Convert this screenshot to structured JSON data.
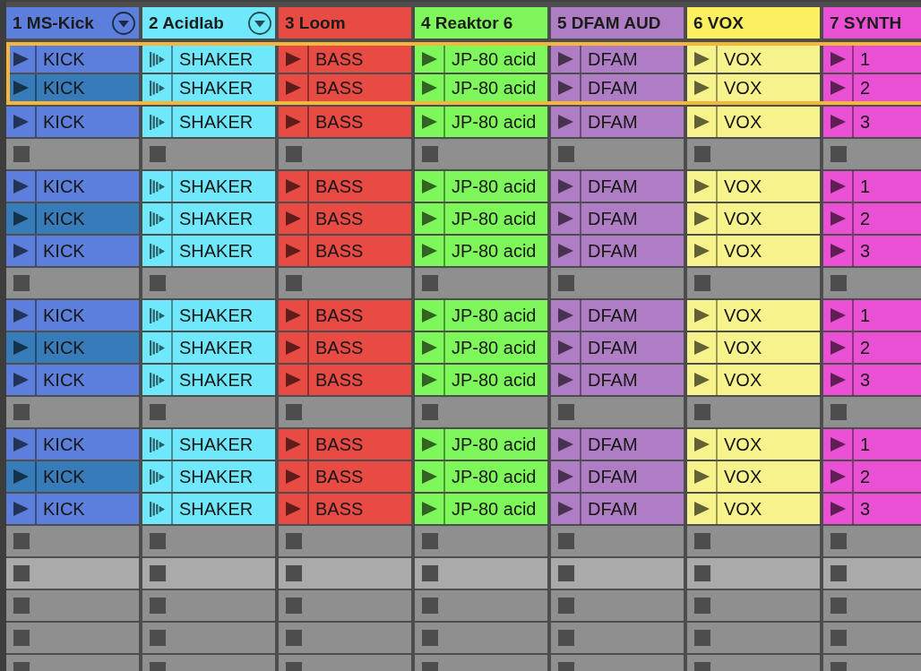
{
  "tracks": [
    {
      "name": "1 MS-Kick",
      "color": "#5c7fdc",
      "dropdown": true
    },
    {
      "name": "2 Acidlab",
      "color": "#6fe8fc",
      "dropdown": true
    },
    {
      "name": "3 Loom",
      "color": "#e84b44",
      "dropdown": false
    },
    {
      "name": "4 Reaktor 6",
      "color": "#7df75a",
      "dropdown": false
    },
    {
      "name": "5 DFAM AUD",
      "color": "#ae7dc4",
      "dropdown": false
    },
    {
      "name": "6 VOX",
      "color": "#fcef60",
      "dropdown": false
    },
    {
      "name": "7 SYNTH",
      "color": "#ea50d3",
      "dropdown": false
    }
  ],
  "scenes": [
    {
      "selected": true,
      "highlighted": false,
      "cells": [
        {
          "kind": "clip",
          "name": "KICK",
          "color": "#5c7fdc"
        },
        {
          "kind": "repeat",
          "name": "SHAKER",
          "color": "#6fe8fc"
        },
        {
          "kind": "clip",
          "name": "BASS",
          "color": "#e84b44"
        },
        {
          "kind": "clip",
          "name": "JP-80 acid",
          "color": "#7df75a"
        },
        {
          "kind": "clip",
          "name": "DFAM",
          "color": "#ae7dc4"
        },
        {
          "kind": "clip",
          "name": "VOX",
          "color": "#f7f38c"
        },
        {
          "kind": "clip",
          "name": "1",
          "color": "#ea50d3"
        }
      ]
    },
    {
      "selected": true,
      "highlighted": false,
      "cells": [
        {
          "kind": "clip",
          "name": "KICK",
          "color": "#377cb8"
        },
        {
          "kind": "repeat",
          "name": "SHAKER",
          "color": "#6fe8fc"
        },
        {
          "kind": "clip",
          "name": "BASS",
          "color": "#e84b44"
        },
        {
          "kind": "clip",
          "name": "JP-80 acid",
          "color": "#7df75a"
        },
        {
          "kind": "clip",
          "name": "DFAM",
          "color": "#ae7dc4"
        },
        {
          "kind": "clip",
          "name": "VOX",
          "color": "#f7f38c"
        },
        {
          "kind": "clip",
          "name": "2",
          "color": "#ea50d3"
        }
      ]
    },
    {
      "selected": false,
      "highlighted": false,
      "cells": [
        {
          "kind": "clip",
          "name": "KICK",
          "color": "#5c7fdc"
        },
        {
          "kind": "repeat",
          "name": "SHAKER",
          "color": "#6fe8fc"
        },
        {
          "kind": "clip",
          "name": "BASS",
          "color": "#e84b44"
        },
        {
          "kind": "clip",
          "name": "JP-80 acid",
          "color": "#7df75a"
        },
        {
          "kind": "clip",
          "name": "DFAM",
          "color": "#ae7dc4"
        },
        {
          "kind": "clip",
          "name": "VOX",
          "color": "#f7f38c"
        },
        {
          "kind": "clip",
          "name": "3",
          "color": "#ea50d3"
        }
      ]
    },
    {
      "selected": false,
      "highlighted": false,
      "cells": [
        {
          "kind": "empty"
        },
        {
          "kind": "empty"
        },
        {
          "kind": "empty"
        },
        {
          "kind": "empty"
        },
        {
          "kind": "empty"
        },
        {
          "kind": "empty"
        },
        {
          "kind": "empty"
        }
      ]
    },
    {
      "selected": false,
      "highlighted": false,
      "cells": [
        {
          "kind": "clip",
          "name": "KICK",
          "color": "#5c7fdc"
        },
        {
          "kind": "repeat",
          "name": "SHAKER",
          "color": "#6fe8fc"
        },
        {
          "kind": "clip",
          "name": "BASS",
          "color": "#e84b44"
        },
        {
          "kind": "clip",
          "name": "JP-80 acid",
          "color": "#7df75a"
        },
        {
          "kind": "clip",
          "name": "DFAM",
          "color": "#ae7dc4"
        },
        {
          "kind": "clip",
          "name": "VOX",
          "color": "#f7f38c"
        },
        {
          "kind": "clip",
          "name": "1",
          "color": "#ea50d3"
        }
      ]
    },
    {
      "selected": false,
      "highlighted": false,
      "cells": [
        {
          "kind": "clip",
          "name": "KICK",
          "color": "#377cb8"
        },
        {
          "kind": "repeat",
          "name": "SHAKER",
          "color": "#6fe8fc"
        },
        {
          "kind": "clip",
          "name": "BASS",
          "color": "#e84b44"
        },
        {
          "kind": "clip",
          "name": "JP-80 acid",
          "color": "#7df75a"
        },
        {
          "kind": "clip",
          "name": "DFAM",
          "color": "#ae7dc4"
        },
        {
          "kind": "clip",
          "name": "VOX",
          "color": "#f7f38c"
        },
        {
          "kind": "clip",
          "name": "2",
          "color": "#ea50d3"
        }
      ]
    },
    {
      "selected": false,
      "highlighted": false,
      "cells": [
        {
          "kind": "clip",
          "name": "KICK",
          "color": "#5c7fdc"
        },
        {
          "kind": "repeat",
          "name": "SHAKER",
          "color": "#6fe8fc"
        },
        {
          "kind": "clip",
          "name": "BASS",
          "color": "#e84b44"
        },
        {
          "kind": "clip",
          "name": "JP-80 acid",
          "color": "#7df75a"
        },
        {
          "kind": "clip",
          "name": "DFAM",
          "color": "#ae7dc4"
        },
        {
          "kind": "clip",
          "name": "VOX",
          "color": "#f7f38c"
        },
        {
          "kind": "clip",
          "name": "3",
          "color": "#ea50d3"
        }
      ]
    },
    {
      "selected": false,
      "highlighted": false,
      "cells": [
        {
          "kind": "empty"
        },
        {
          "kind": "empty"
        },
        {
          "kind": "empty"
        },
        {
          "kind": "empty"
        },
        {
          "kind": "empty"
        },
        {
          "kind": "empty"
        },
        {
          "kind": "empty"
        }
      ]
    },
    {
      "selected": false,
      "highlighted": false,
      "cells": [
        {
          "kind": "clip",
          "name": "KICK",
          "color": "#5c7fdc"
        },
        {
          "kind": "repeat",
          "name": "SHAKER",
          "color": "#6fe8fc"
        },
        {
          "kind": "clip",
          "name": "BASS",
          "color": "#e84b44"
        },
        {
          "kind": "clip",
          "name": "JP-80 acid",
          "color": "#7df75a"
        },
        {
          "kind": "clip",
          "name": "DFAM",
          "color": "#ae7dc4"
        },
        {
          "kind": "clip",
          "name": "VOX",
          "color": "#f7f38c"
        },
        {
          "kind": "clip",
          "name": "1",
          "color": "#ea50d3"
        }
      ]
    },
    {
      "selected": false,
      "highlighted": false,
      "cells": [
        {
          "kind": "clip",
          "name": "KICK",
          "color": "#377cb8"
        },
        {
          "kind": "repeat",
          "name": "SHAKER",
          "color": "#6fe8fc"
        },
        {
          "kind": "clip",
          "name": "BASS",
          "color": "#e84b44"
        },
        {
          "kind": "clip",
          "name": "JP-80 acid",
          "color": "#7df75a"
        },
        {
          "kind": "clip",
          "name": "DFAM",
          "color": "#ae7dc4"
        },
        {
          "kind": "clip",
          "name": "VOX",
          "color": "#f7f38c"
        },
        {
          "kind": "clip",
          "name": "2",
          "color": "#ea50d3"
        }
      ]
    },
    {
      "selected": false,
      "highlighted": false,
      "cells": [
        {
          "kind": "clip",
          "name": "KICK",
          "color": "#5c7fdc"
        },
        {
          "kind": "repeat",
          "name": "SHAKER",
          "color": "#6fe8fc"
        },
        {
          "kind": "clip",
          "name": "BASS",
          "color": "#e84b44"
        },
        {
          "kind": "clip",
          "name": "JP-80 acid",
          "color": "#7df75a"
        },
        {
          "kind": "clip",
          "name": "DFAM",
          "color": "#ae7dc4"
        },
        {
          "kind": "clip",
          "name": "VOX",
          "color": "#f7f38c"
        },
        {
          "kind": "clip",
          "name": "3",
          "color": "#ea50d3"
        }
      ]
    },
    {
      "selected": false,
      "highlighted": false,
      "cells": [
        {
          "kind": "empty"
        },
        {
          "kind": "empty"
        },
        {
          "kind": "empty"
        },
        {
          "kind": "empty"
        },
        {
          "kind": "empty"
        },
        {
          "kind": "empty"
        },
        {
          "kind": "empty"
        }
      ]
    },
    {
      "selected": false,
      "highlighted": false,
      "cells": [
        {
          "kind": "clip",
          "name": "KICK",
          "color": "#5c7fdc"
        },
        {
          "kind": "repeat",
          "name": "SHAKER",
          "color": "#6fe8fc"
        },
        {
          "kind": "clip",
          "name": "BASS",
          "color": "#e84b44"
        },
        {
          "kind": "clip",
          "name": "JP-80 acid",
          "color": "#7df75a"
        },
        {
          "kind": "clip",
          "name": "DFAM",
          "color": "#ae7dc4"
        },
        {
          "kind": "clip",
          "name": "VOX",
          "color": "#f7f38c"
        },
        {
          "kind": "clip",
          "name": "1",
          "color": "#ea50d3"
        }
      ]
    },
    {
      "selected": false,
      "highlighted": false,
      "cells": [
        {
          "kind": "clip",
          "name": "KICK",
          "color": "#377cb8"
        },
        {
          "kind": "repeat",
          "name": "SHAKER",
          "color": "#6fe8fc"
        },
        {
          "kind": "clip",
          "name": "BASS",
          "color": "#e84b44"
        },
        {
          "kind": "clip",
          "name": "JP-80 acid",
          "color": "#7df75a"
        },
        {
          "kind": "clip",
          "name": "DFAM",
          "color": "#ae7dc4"
        },
        {
          "kind": "clip",
          "name": "VOX",
          "color": "#f7f38c"
        },
        {
          "kind": "clip",
          "name": "2",
          "color": "#ea50d3"
        }
      ]
    },
    {
      "selected": false,
      "highlighted": false,
      "cells": [
        {
          "kind": "clip",
          "name": "KICK",
          "color": "#5c7fdc"
        },
        {
          "kind": "repeat",
          "name": "SHAKER",
          "color": "#6fe8fc"
        },
        {
          "kind": "clip",
          "name": "BASS",
          "color": "#e84b44"
        },
        {
          "kind": "clip",
          "name": "JP-80 acid",
          "color": "#7df75a"
        },
        {
          "kind": "clip",
          "name": "DFAM",
          "color": "#ae7dc4"
        },
        {
          "kind": "clip",
          "name": "VOX",
          "color": "#f7f38c"
        },
        {
          "kind": "clip",
          "name": "3",
          "color": "#ea50d3"
        }
      ]
    },
    {
      "selected": false,
      "highlighted": false,
      "cells": [
        {
          "kind": "empty"
        },
        {
          "kind": "empty"
        },
        {
          "kind": "empty"
        },
        {
          "kind": "empty"
        },
        {
          "kind": "empty"
        },
        {
          "kind": "empty"
        },
        {
          "kind": "empty"
        }
      ]
    },
    {
      "selected": false,
      "highlighted": true,
      "cells": [
        {
          "kind": "empty"
        },
        {
          "kind": "empty"
        },
        {
          "kind": "empty"
        },
        {
          "kind": "empty"
        },
        {
          "kind": "empty"
        },
        {
          "kind": "empty"
        },
        {
          "kind": "empty"
        }
      ]
    },
    {
      "selected": false,
      "highlighted": false,
      "cells": [
        {
          "kind": "empty"
        },
        {
          "kind": "empty"
        },
        {
          "kind": "empty"
        },
        {
          "kind": "empty"
        },
        {
          "kind": "empty"
        },
        {
          "kind": "empty"
        },
        {
          "kind": "empty"
        }
      ]
    },
    {
      "selected": false,
      "highlighted": false,
      "cells": [
        {
          "kind": "empty"
        },
        {
          "kind": "empty"
        },
        {
          "kind": "empty"
        },
        {
          "kind": "empty"
        },
        {
          "kind": "empty"
        },
        {
          "kind": "empty"
        },
        {
          "kind": "empty"
        }
      ]
    },
    {
      "selected": false,
      "highlighted": false,
      "cells": [
        {
          "kind": "empty"
        },
        {
          "kind": "empty"
        },
        {
          "kind": "empty"
        },
        {
          "kind": "empty"
        },
        {
          "kind": "empty"
        },
        {
          "kind": "empty"
        },
        {
          "kind": "empty"
        }
      ]
    }
  ]
}
